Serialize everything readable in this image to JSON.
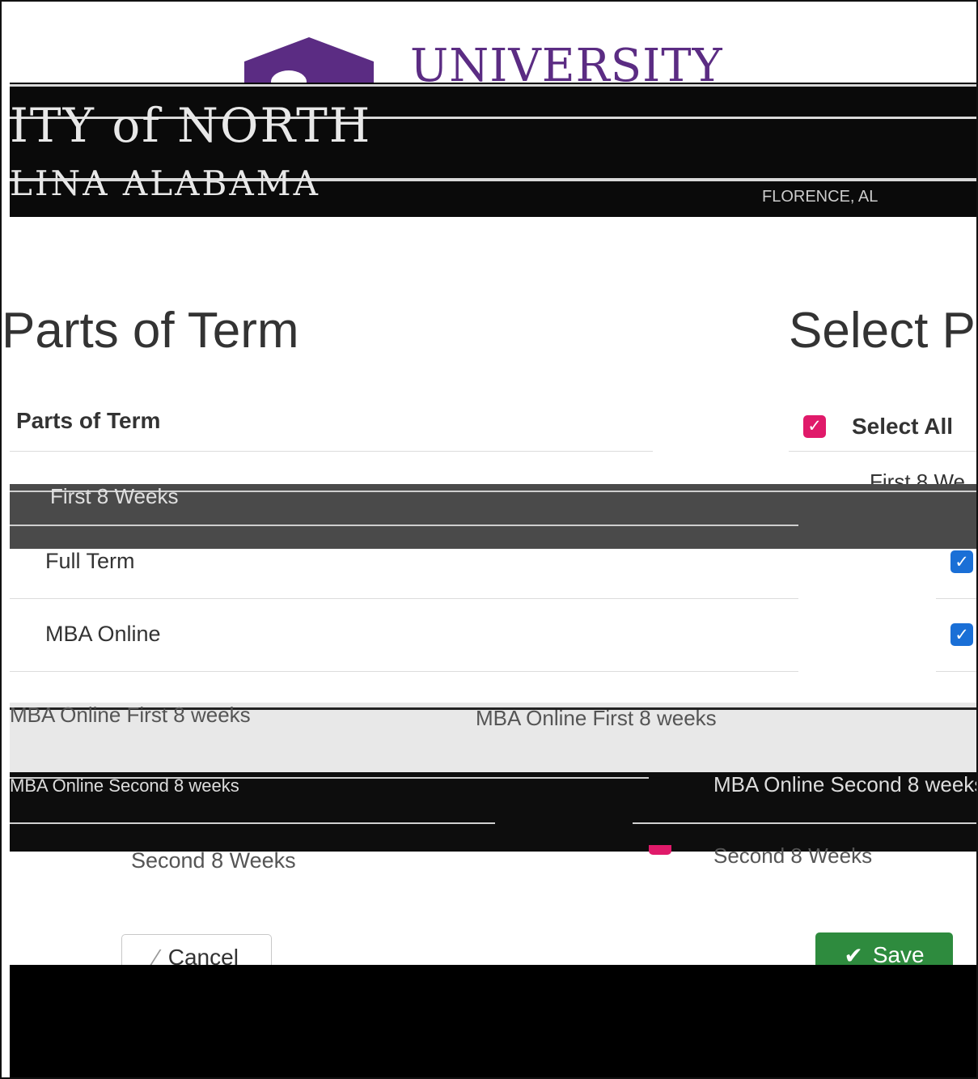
{
  "header": {
    "logo_word": "UNIVERSITY",
    "band_title": "ITY of NORTH",
    "band_subtitle": "LINA ALABAMA",
    "band_right": "FLORENCE, AL"
  },
  "left": {
    "heading": "Parts of Term",
    "table_header": "Parts of Term",
    "rows": [
      {
        "label": "First 8 Weeks"
      },
      {
        "label": "Full Term"
      },
      {
        "label": "MBA Online"
      },
      {
        "label": "MBA Online First 8 weeks"
      },
      {
        "label": "MBA Online Second 8 weeks"
      },
      {
        "label": "Second 8 Weeks"
      }
    ]
  },
  "right": {
    "heading": "Select P",
    "select_all_label": "Select All",
    "first_row_label": "First 8 We",
    "lower_label": "MBA Online Second 8 weeks",
    "last_label": "Second 8 Weeks"
  },
  "buttons": {
    "cancel_label": "Cancel",
    "save_label": "Save"
  },
  "colors": {
    "brand_purple": "#5b2c83",
    "checkbox_blue": "#1a6fd6",
    "checkbox_pink": "#e01a6a",
    "save_green": "#2e8b3e"
  },
  "icons": {
    "checkbox": "check-icon",
    "cancel": "slash-icon",
    "save": "check-icon"
  }
}
